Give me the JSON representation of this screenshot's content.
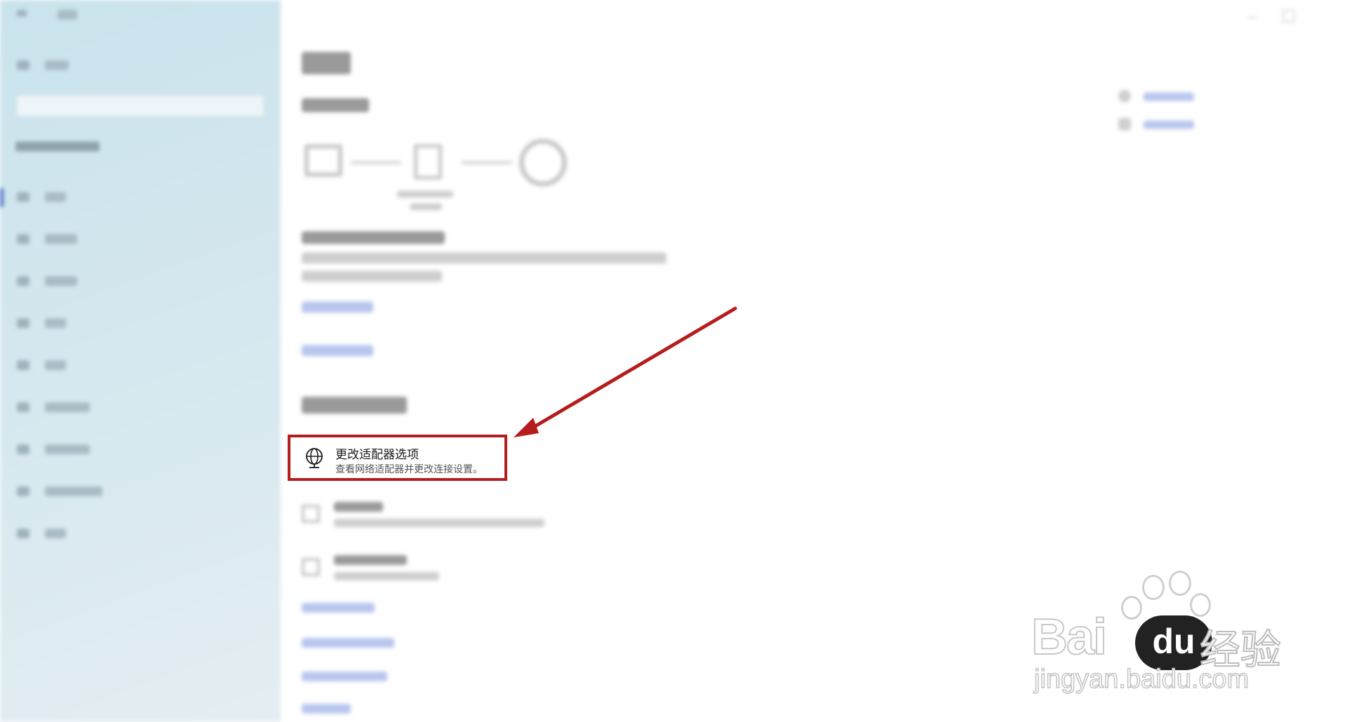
{
  "adapter_option": {
    "title": "更改适配器选项",
    "description": "查看网络适配器并更改连接设置。"
  },
  "highlight_color": "#b51d1d",
  "watermark": {
    "brand": "Bai",
    "du": "du",
    "cn": "经验",
    "url": "jingyan.baidu.com"
  },
  "icons": {
    "adapter": "globe-network-adapter-icon",
    "arrow": "red-arrow-annotation"
  }
}
